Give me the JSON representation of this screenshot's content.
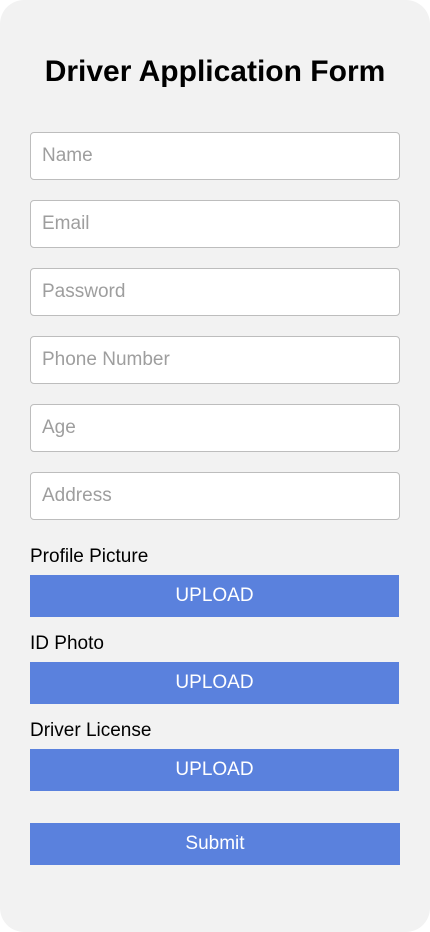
{
  "form": {
    "title": "Driver Application Form",
    "fields": {
      "name": {
        "placeholder": "Name",
        "value": ""
      },
      "email": {
        "placeholder": "Email",
        "value": ""
      },
      "password": {
        "placeholder": "Password",
        "value": ""
      },
      "phone": {
        "placeholder": "Phone Number",
        "value": ""
      },
      "age": {
        "placeholder": "Age",
        "value": ""
      },
      "address": {
        "placeholder": "Address",
        "value": ""
      }
    },
    "uploads": {
      "profile_picture": {
        "label": "Profile Picture",
        "button_label": "UPLOAD"
      },
      "id_photo": {
        "label": "ID Photo",
        "button_label": "UPLOAD"
      },
      "driver_license": {
        "label": "Driver License",
        "button_label": "UPLOAD"
      }
    },
    "submit_label": "Submit"
  },
  "colors": {
    "background": "#f2f2f2",
    "button": "#5a81dd",
    "button_text": "#ffffff",
    "field_border": "#bdbdbd",
    "placeholder": "#9e9e9e"
  }
}
